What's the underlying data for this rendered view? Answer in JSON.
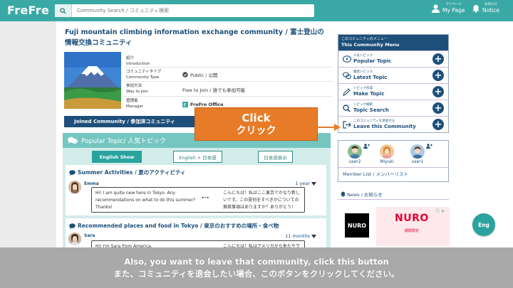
{
  "header": {
    "logo": "FreFre",
    "search_placeholder": "Community Search / コミュニティ検索",
    "mypage_sub": "マイページ",
    "mypage_label": "My Page",
    "notice_sub": "お知らせ",
    "notice_label": "Notice"
  },
  "community": {
    "title": "Fuji mountain climbing information exchange community / 富士登山の情報交換コミュニティ",
    "info": [
      {
        "label_ja": "紹介",
        "label_en": "Introduction",
        "value": ""
      },
      {
        "label_ja": "コミュニティタイプ",
        "label_en": "Community Type",
        "value": "Public / 公開"
      },
      {
        "label_ja": "参加方法",
        "label_en": "Way to Join",
        "value": "Free to Join / 誰でも参加可能"
      },
      {
        "label_ja": "管理者",
        "label_en": "Manager",
        "value": "FreFre Office"
      }
    ],
    "joined_label": "Joined Community / 参加済コミュニティ"
  },
  "popular": {
    "heading": "Popular Topic/ 人気トピック",
    "lang_buttons": [
      "English Show",
      "English + 日本語",
      "日本語表示"
    ]
  },
  "posts": [
    {
      "title": "Summer Activities / 夏のアクティビティ",
      "user": "Emma",
      "time": "1 year",
      "text_en": "Hi! I am quite new here in Tokyo. Any recommendations on what to do this summer? Thanks!",
      "text_ja": "こんにちは！私はここ東京でかなり新しいです。この夏何をすべきかについての推奨事項はありますか？ありがとう！",
      "arrow": "⟷"
    },
    {
      "title": "Recommended places and food in Tokyo / 東京のおすすめの場所・食べ物",
      "user": "Sara",
      "time": "11 months",
      "text_en": "Hi! I'm Sara from America.",
      "text_ja": "こんにちは！私はアメリカから来たサラです。",
      "arrow": "⟷"
    }
  ],
  "menu": {
    "head_ja": "このコミュニティのメニュー",
    "head_en": "This Community Menu",
    "items": [
      {
        "sub": "人気トピック",
        "label": "Popular Topic",
        "icon": "fire-chat-icon"
      },
      {
        "sub": "最新トピック",
        "label": "Latest Topic",
        "icon": "chat-bubbles-icon"
      },
      {
        "sub": "トピック作成",
        "label": "Make Topic",
        "icon": "pencil-icon"
      },
      {
        "sub": "トピック検索",
        "label": "Topic Search",
        "icon": "search-icon"
      },
      {
        "sub": "このコミュニティを退会する",
        "label": "Leave this Community",
        "icon": "exit-icon"
      }
    ]
  },
  "members": {
    "list": [
      "user2",
      "Miyuki",
      "user1"
    ],
    "list_link": "Member List / メンバーリスト"
  },
  "news": {
    "label": "News / お知らせ"
  },
  "ad": {
    "box_text": "NURO",
    "banner_logo": "NURO",
    "banner_sub": "期間限定"
  },
  "eng_button": "Eng",
  "callout": {
    "en": "Click",
    "ja": "クリック"
  },
  "caption": {
    "en": "Also, you want to leave that community, click this button",
    "ja": "また、コミュニティを退会したい場合、このボタンをクリックしてください。"
  },
  "colors": {
    "teal": "#3aa9a6",
    "navy": "#1d4f7a",
    "orange": "#e87b27",
    "caption_bg": "#a9a9a9"
  }
}
